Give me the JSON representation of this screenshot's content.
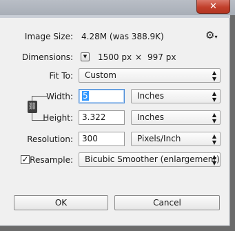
{
  "window": {
    "close_glyph": "✕"
  },
  "image_size": {
    "label": "Image Size:",
    "value": "4.28M (was 388.9K)",
    "settings_icon": "gear-icon"
  },
  "dimensions": {
    "label": "Dimensions:",
    "width_value": "1500 px",
    "separator": "×",
    "height_value": "997 px"
  },
  "fit_to": {
    "label": "Fit To:",
    "selected": "Custom"
  },
  "width": {
    "label": "Width:",
    "value": "5",
    "unit": "Inches"
  },
  "height": {
    "label": "Height:",
    "value": "3.322",
    "unit": "Inches"
  },
  "resolution": {
    "label": "Resolution:",
    "value": "300",
    "unit": "Pixels/Inch"
  },
  "resample": {
    "label": "Resample:",
    "checked": true,
    "selected": "Bicubic Smoother (enlargement)"
  },
  "buttons": {
    "ok": "OK",
    "cancel": "Cancel"
  }
}
